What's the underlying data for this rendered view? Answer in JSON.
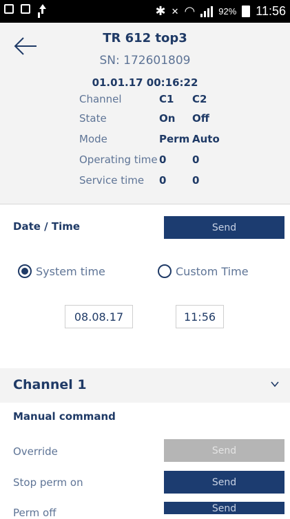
{
  "statusbar": {
    "battery": "92%",
    "time": "11:56"
  },
  "device": {
    "title": "TR 612 top3",
    "serial": "SN: 172601809",
    "datetime": "01.01.17 00:16:22"
  },
  "info_table": [
    {
      "label": "Channel",
      "c1": "C1",
      "c2": "C2"
    },
    {
      "label": "State",
      "c1": "On",
      "c2": "Off"
    },
    {
      "label": "Mode",
      "c1": "Perm",
      "c2": "Auto"
    },
    {
      "label": "Operating time",
      "c1": "0",
      "c2": "0"
    },
    {
      "label": "Service time",
      "c1": "0",
      "c2": "0"
    }
  ],
  "datetime_section": {
    "title": "Date / Time",
    "send_label": "Send",
    "system_time_label": "System time",
    "custom_time_label": "Custom Time",
    "date_value": "08.08.17",
    "time_value": "11:56"
  },
  "channel": {
    "title": "Channel 1",
    "manual_command": "Manual command",
    "commands": [
      {
        "label": "Override",
        "button": "Send",
        "enabled": false
      },
      {
        "label": "Stop perm on",
        "button": "Send",
        "enabled": true
      },
      {
        "label": "Perm off",
        "button": "Send",
        "enabled": true
      }
    ]
  },
  "colors": {
    "primary": "#1c3c70",
    "text_dark": "#1f3a66",
    "text_muted": "#5e7496",
    "disabled": "#b5b5b5",
    "panel": "#f3f3f3"
  }
}
